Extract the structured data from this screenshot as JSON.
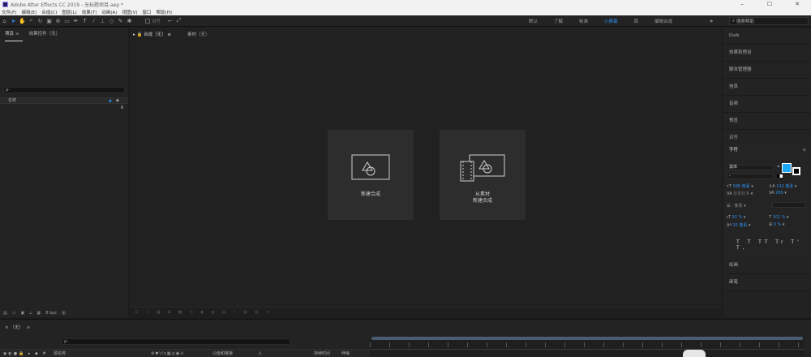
{
  "titlebar": {
    "title": "Adobe After Effects CC 2019 - 无标题项目.aep *"
  },
  "menubar": {
    "items": [
      "文件(F)",
      "编辑(E)",
      "合成(C)",
      "图层(L)",
      "效果(T)",
      "动画(A)",
      "视图(V)",
      "窗口",
      "帮助(H)"
    ]
  },
  "toolbar": {
    "snap_label": "对齐",
    "workspaces": [
      "默认",
      "了解",
      "标准",
      "小屏幕",
      "库",
      "编辑合成"
    ],
    "active_workspace": "小屏幕",
    "search_placeholder": "搜索帮助"
  },
  "project_panel": {
    "tabs": [
      "项目",
      "效果控件（无）"
    ],
    "search_glyph": "ρ-",
    "col_name": "名称",
    "footer_bpc": "8 bpc"
  },
  "composition_panel": {
    "tabs": [
      "合成（无）",
      "素材（无）"
    ],
    "cards": [
      {
        "label_line1": "新建合成",
        "label_line2": ""
      },
      {
        "label_line1": "从素材",
        "label_line2": "新建合成"
      }
    ]
  },
  "right_panel": {
    "top_items": [
      "Duik",
      "效果和预设",
      "脚本管理器",
      "信息",
      "音频",
      "预览",
      "对齐"
    ],
    "character": {
      "title": "字符",
      "font_family": "黑体",
      "font_style": "-",
      "font_size": "588 像素",
      "leading": "142 像素",
      "kerning": "度量标准",
      "tracking": "266",
      "stroke_width": "- 像素",
      "vertical_scale": "92 %",
      "horizontal_scale": "101 %",
      "baseline_shift": "20 像素",
      "tsume": "0 %",
      "fill_color": "#1ea7f5",
      "text_styles": "T T TT Tr T' T,"
    },
    "bottom_items": [
      "绘画",
      "画笔"
    ]
  },
  "timeline": {
    "tab": "（无）",
    "search_glyph": "ρ-",
    "col_source": "源名称",
    "col_parent": "父级和链接",
    "col_in": "入",
    "col_duration": "持续时间",
    "col_stretch": "伸缩"
  }
}
